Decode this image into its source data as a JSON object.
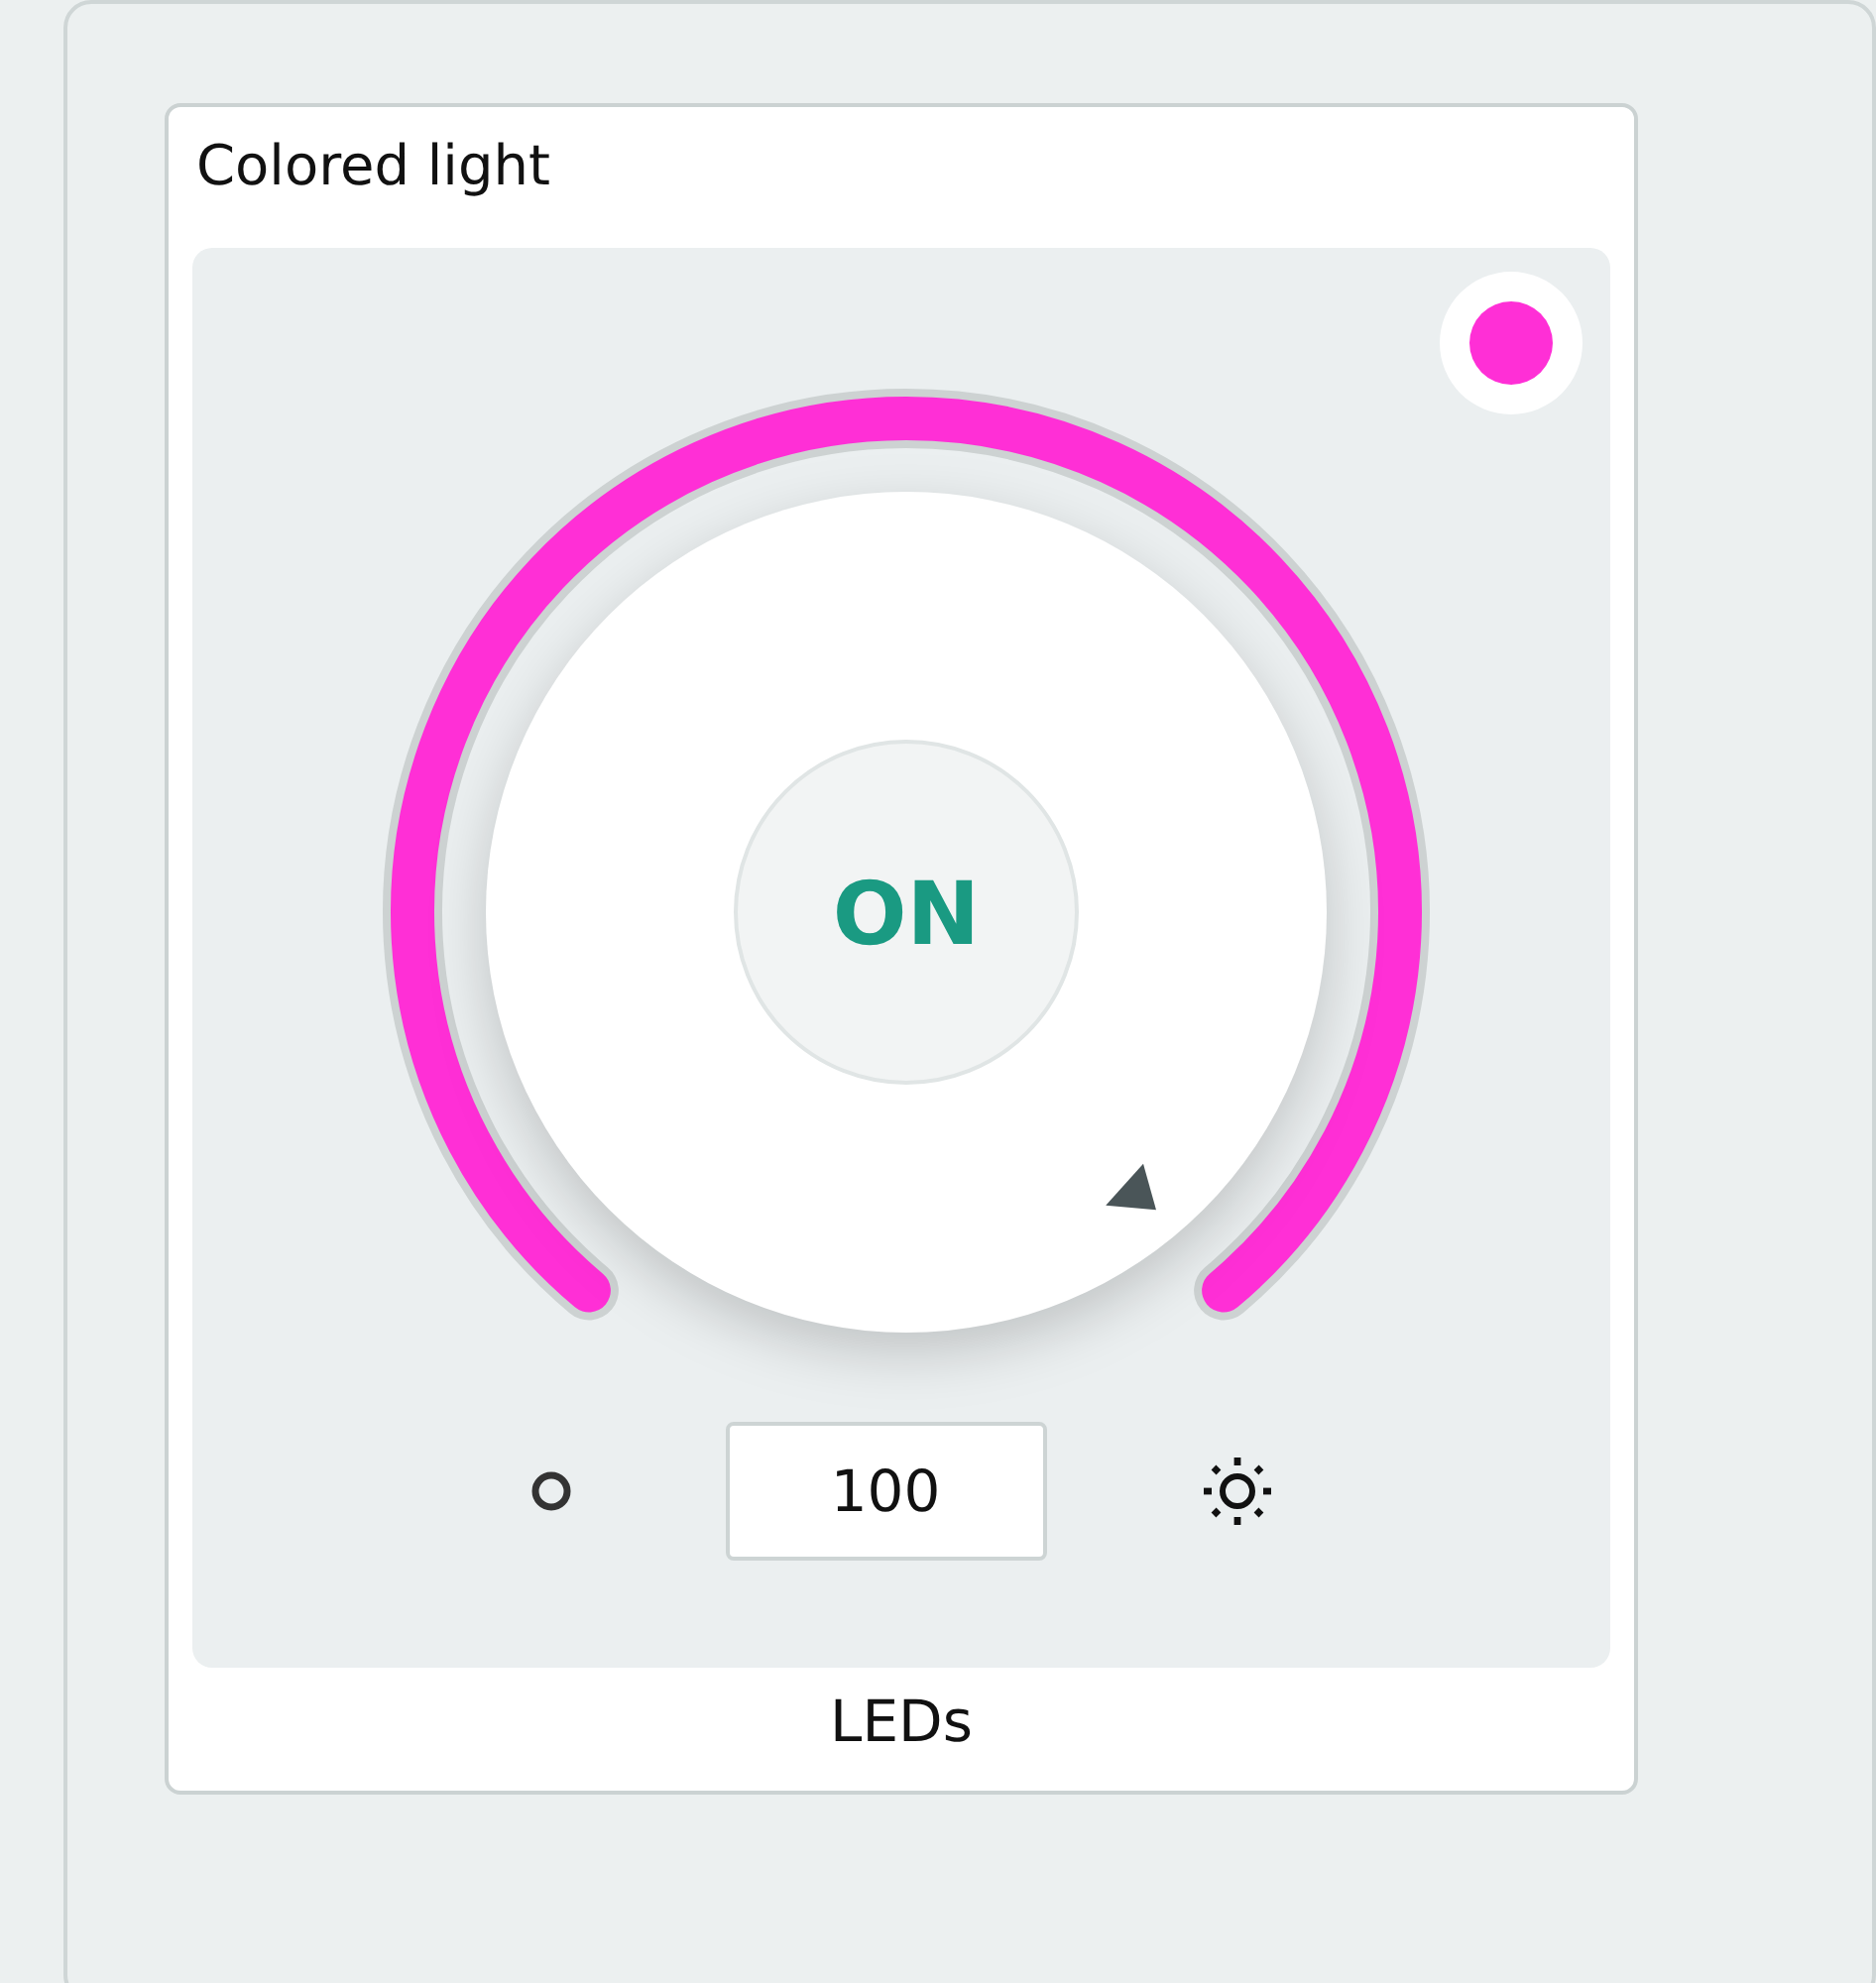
{
  "card": {
    "title": "Colored light",
    "footer": "LEDs"
  },
  "light": {
    "color": "#ff2fd6",
    "on": true,
    "state_label": "ON",
    "value": "100"
  }
}
